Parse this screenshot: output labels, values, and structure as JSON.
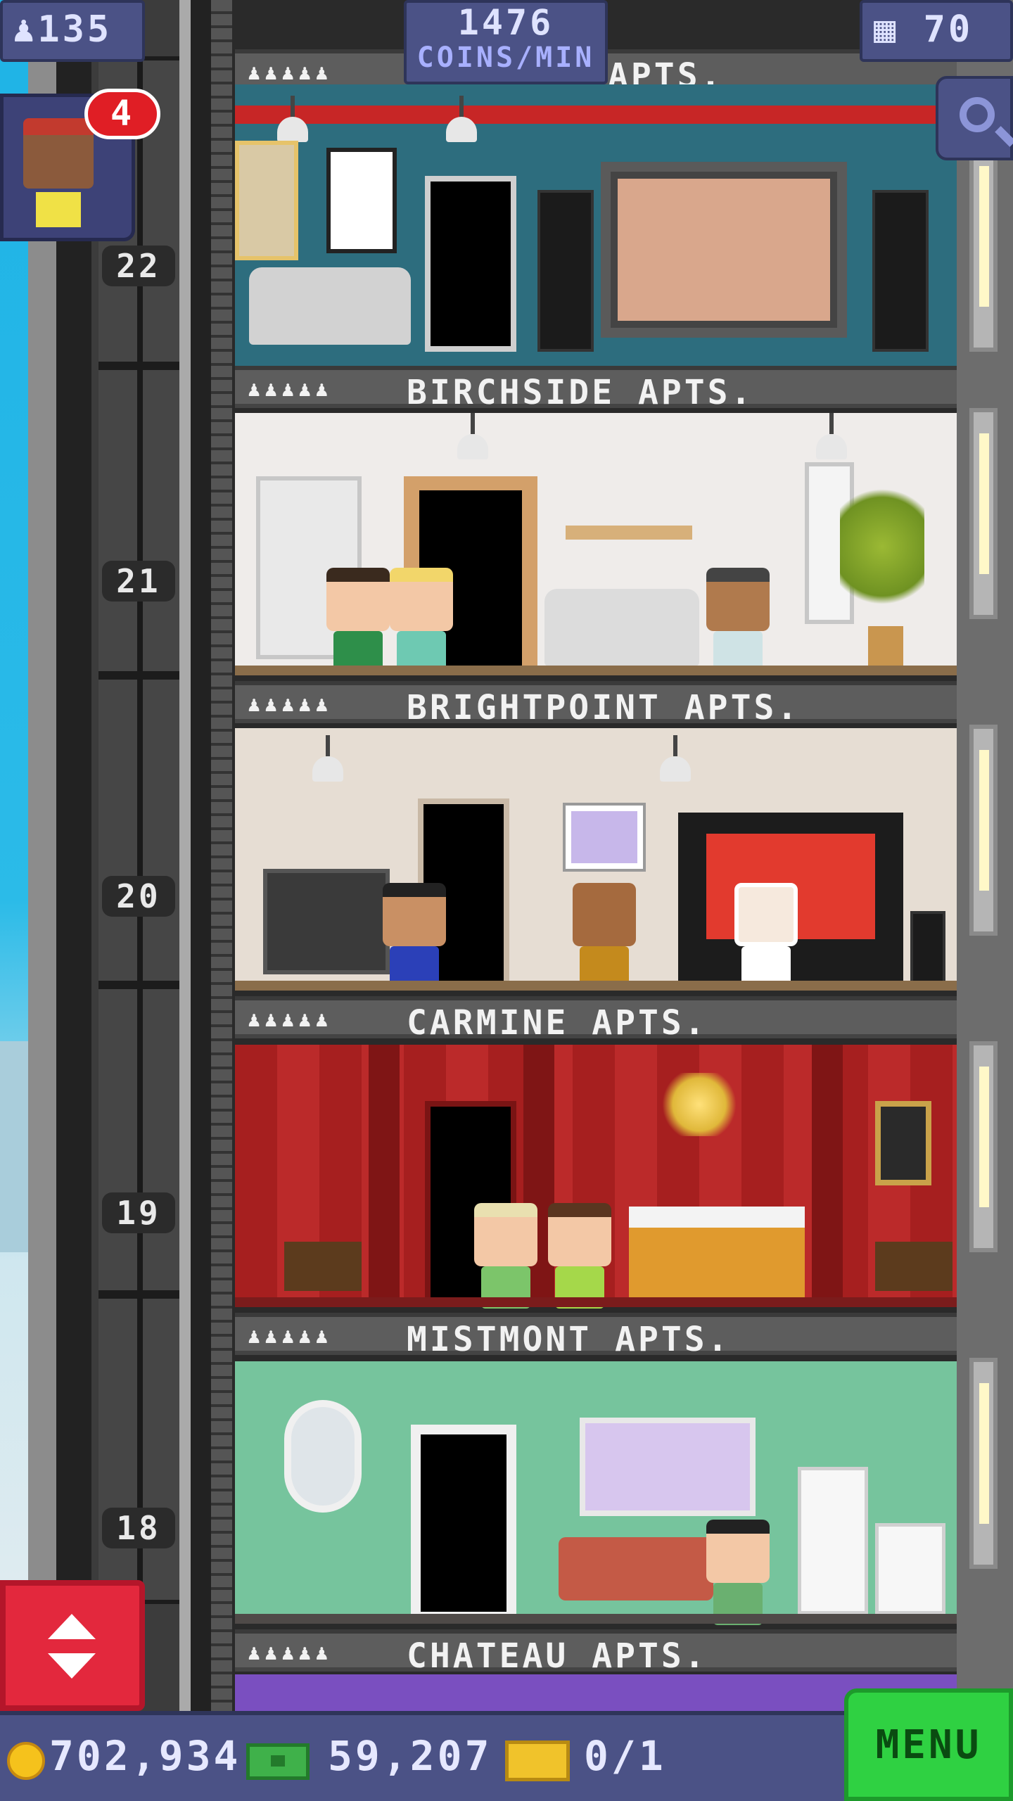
{
  "hud": {
    "population": "135",
    "coins_per_min_value": "1476",
    "coins_per_min_label": "COINS/MIN",
    "floor_count": "70",
    "notification_count": "4"
  },
  "top_label_partial": "APTS.",
  "floors": [
    {
      "number": "22",
      "label": "BIRCHSIDE APTS.",
      "occupancy": "♟♟♟♟♟"
    },
    {
      "number": "21",
      "label": "BRIGHTPOINT APTS.",
      "occupancy": "♟♟♟♟♟"
    },
    {
      "number": "20",
      "label": "CARMINE APTS.",
      "occupancy": "♟♟♟♟♟"
    },
    {
      "number": "19",
      "label": "MISTMONT APTS.",
      "occupancy": "♟♟♟♟♟"
    },
    {
      "number": "18",
      "label": "CHATEAU APTS.",
      "occupancy": "♟♟♟♟♟"
    }
  ],
  "currency": {
    "coins": "702,934",
    "bux": "59,207",
    "tickets": "0/1"
  },
  "menu_label": "MENU",
  "icons": {
    "population": "person-icon",
    "floors": "building-icon",
    "search": "magnifier-icon",
    "elevator": "up-down-arrows-icon"
  },
  "colors": {
    "hud_bg": "#4b5286",
    "menu_green": "#2fd142",
    "elevator_red": "#e3283d",
    "badge_red": "#e01e25"
  }
}
